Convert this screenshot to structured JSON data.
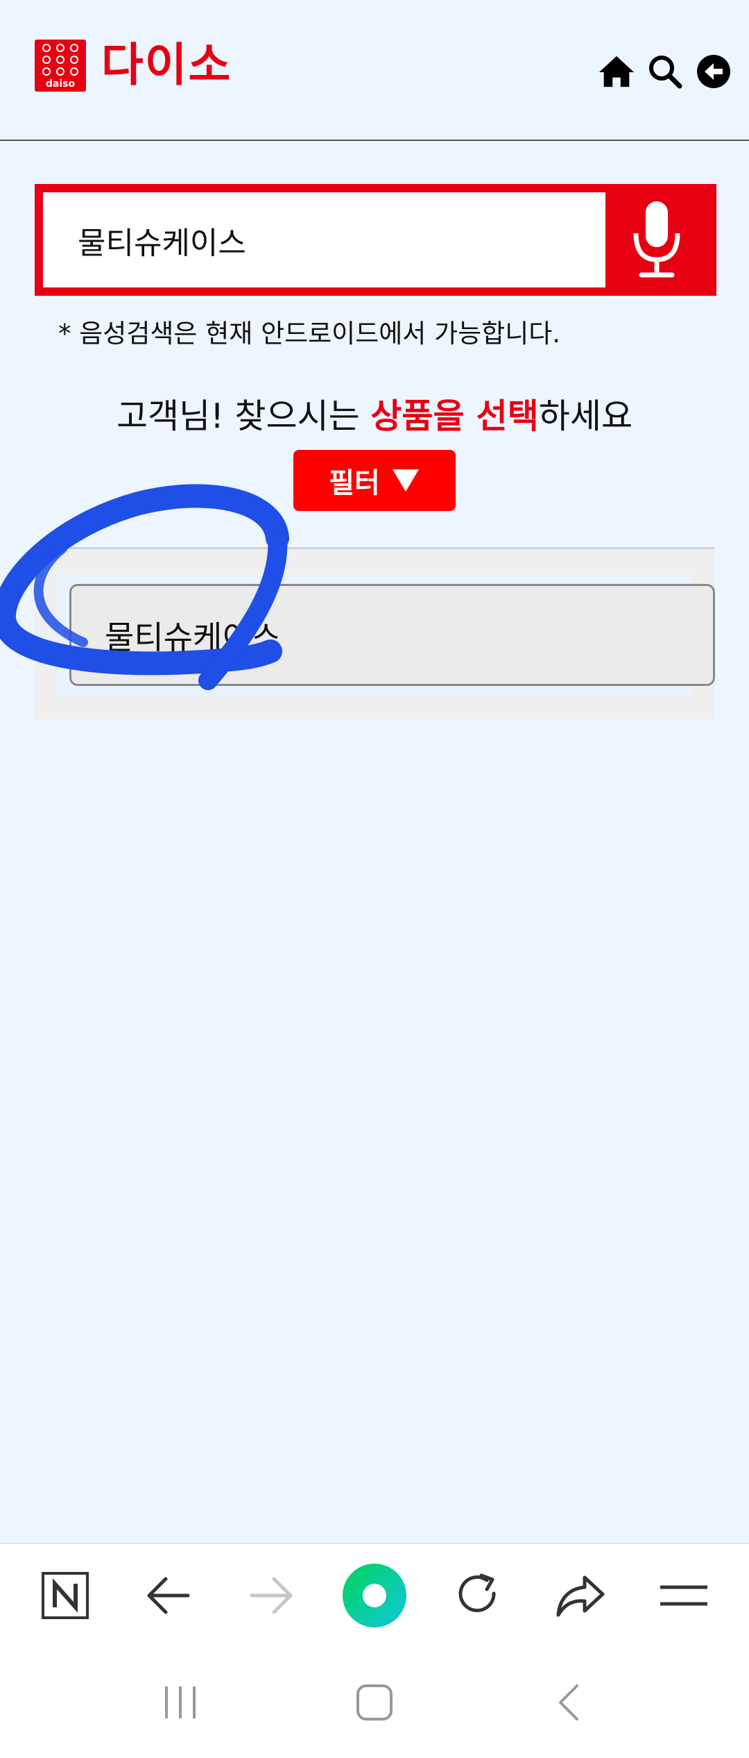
{
  "header": {
    "logo_sub": "daiso",
    "logo_text": "다이소",
    "icons": [
      "home-icon",
      "search-icon",
      "back-circle-icon"
    ]
  },
  "search": {
    "value": "물티슈케이스",
    "mic_icon": "microphone-icon",
    "notice": "* 음성검색은 현재 안드로이드에서 가능합니다."
  },
  "guide": {
    "prefix": "고객님! 찾으시는 ",
    "highlight": "상품을 선택",
    "suffix": "하세요"
  },
  "filter": {
    "label": "필터"
  },
  "results": [
    {
      "label": "물티슈케이스"
    }
  ],
  "colors": {
    "brand_red": "#e60012",
    "page_bg": "#edf5ff",
    "scribble_blue": "#1f4fe6",
    "naver_green": "#03c75a"
  },
  "browser_bar": {
    "icons": [
      "naver-n-icon",
      "back-arrow-icon",
      "forward-arrow-icon",
      "green-dot-icon",
      "refresh-icon",
      "share-icon",
      "menu-icon"
    ]
  },
  "system_nav": {
    "icons": [
      "recents-icon",
      "home-square-icon",
      "back-chevron-icon"
    ]
  }
}
